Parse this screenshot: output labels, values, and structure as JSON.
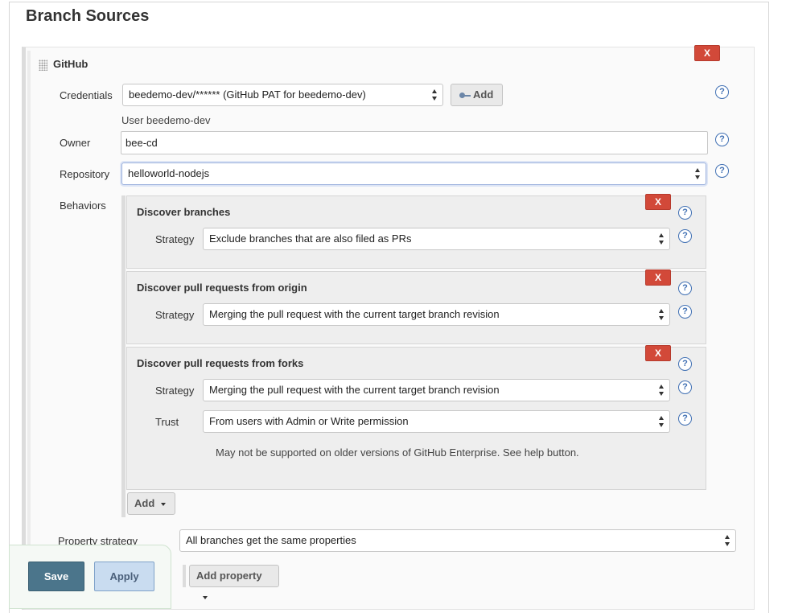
{
  "section": {
    "title": "Branch Sources"
  },
  "github": {
    "title": "GitHub",
    "delete_label": "X",
    "credentials": {
      "label": "Credentials",
      "value": "beedemo-dev/****** (GitHub PAT for beedemo-dev)",
      "add_label": "Add",
      "user_note": "User beedemo-dev"
    },
    "owner": {
      "label": "Owner",
      "value": "bee-cd"
    },
    "repository": {
      "label": "Repository",
      "value": "helloworld-nodejs"
    },
    "behaviors": {
      "label": "Behaviors",
      "items": [
        {
          "title": "Discover branches",
          "delete_label": "X",
          "strategy_label": "Strategy",
          "strategy_value": "Exclude branches that are also filed as PRs"
        },
        {
          "title": "Discover pull requests from origin",
          "delete_label": "X",
          "strategy_label": "Strategy",
          "strategy_value": "Merging the pull request with the current target branch revision"
        },
        {
          "title": "Discover pull requests from forks",
          "delete_label": "X",
          "strategy_label": "Strategy",
          "strategy_value": "Merging the pull request with the current target branch revision",
          "trust_label": "Trust",
          "trust_value": "From users with Admin or Write permission",
          "note": "May not be supported on older versions of GitHub Enterprise. See help button."
        }
      ],
      "add_label": "Add"
    },
    "property_strategy": {
      "label": "Property strategy",
      "value": "All branches get the same properties",
      "add_property_label": "Add property"
    }
  },
  "help_glyph": "?",
  "footer": {
    "save_label": "Save",
    "apply_label": "Apply"
  },
  "colors": {
    "delete": "#d24939",
    "save": "#4b758b",
    "apply": "#c9dcf0",
    "help": "#3f6fb3"
  }
}
